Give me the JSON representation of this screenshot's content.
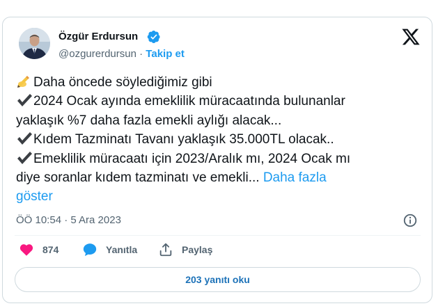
{
  "author": {
    "name": "Özgür Erdursun",
    "handle": "@ozgurerdursun",
    "separator": "·",
    "follow_label": "Takip et"
  },
  "tweet": {
    "lines": [
      "Daha öncede söylediğimiz gibi",
      "2024 Ocak ayında emeklilik müracaatında bulunanlar",
      "yaklaşık %7 daha fazla emekli aylığı alacak...",
      "Kıdem Tazminatı Tavanı yaklaşık 35.000TL olacak..",
      "Emeklilik müracaatı için 2023/Aralık mı, 2024 Ocak mı",
      "diye soranlar kıdem tazminatı ve emekli..."
    ],
    "show_more_part1": "Daha fazla",
    "show_more_part2": "göster",
    "line_icons": [
      "writing-hand-icon",
      "check-mark-icon",
      null,
      "check-mark-icon",
      "check-mark-icon",
      null
    ]
  },
  "meta": {
    "timestamp": "ÖÖ 10:54 · 5 Ara 2023"
  },
  "actions": {
    "like_count": "874",
    "reply_label": "Yanıtla",
    "share_label": "Paylaş"
  },
  "replies_button": {
    "label": "203 yanıtı oku"
  },
  "colors": {
    "accent": "#1d9bf0",
    "like": "#f91880",
    "muted": "#536471",
    "border": "#cfd9de"
  }
}
